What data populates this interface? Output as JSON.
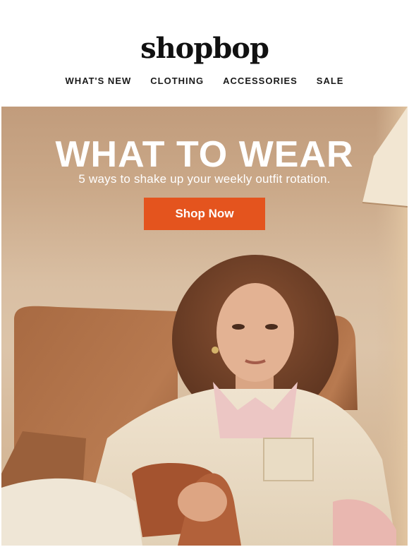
{
  "brand": {
    "logo_text": "shopbop"
  },
  "nav": {
    "items": [
      {
        "label": "WHAT'S NEW"
      },
      {
        "label": "CLOTHING"
      },
      {
        "label": "ACCESSORIES"
      },
      {
        "label": "SALE"
      }
    ]
  },
  "hero": {
    "title": "WHAT TO WEAR",
    "subtitle": "5 ways to shake up your weekly outfit rotation.",
    "cta_label": "Shop Now",
    "cta_color": "#e4541e",
    "image_description_icon": "model-in-armchair-photo"
  }
}
